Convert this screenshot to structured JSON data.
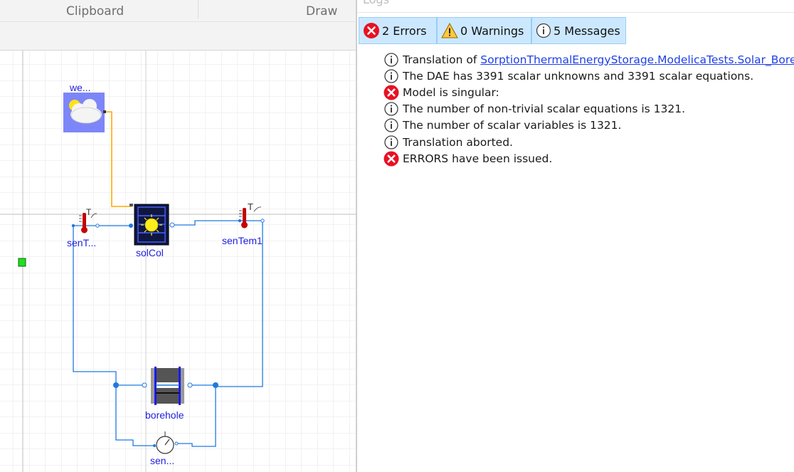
{
  "ribbon": {
    "clipboard_label": "Clipboard",
    "draw_label": "Draw"
  },
  "diagram": {
    "components": [
      {
        "id": "weather",
        "label": "we..."
      },
      {
        "id": "sen_t_left",
        "label": "senT..."
      },
      {
        "id": "solcol",
        "label": "solCol"
      },
      {
        "id": "sentem1",
        "label": "senTem1"
      },
      {
        "id": "borehole",
        "label": "borehole"
      },
      {
        "id": "sen_bottom",
        "label": "sen..."
      }
    ],
    "sensor_glyph": "T"
  },
  "logs": {
    "title": "Logs",
    "tabs": [
      {
        "icon": "error-icon",
        "label": "2 Errors"
      },
      {
        "icon": "warning-icon",
        "label": "0 Warnings"
      },
      {
        "icon": "info-icon",
        "label": "5 Messages"
      }
    ],
    "messages": [
      {
        "icon": "info-icon",
        "prefix": "Translation of ",
        "link": "SorptionThermalEnergyStorage.ModelicaTests.Solar_BoreHole",
        "suffix": ":"
      },
      {
        "icon": "info-icon",
        "text": "The DAE has 3391 scalar unknowns and 3391 scalar equations."
      },
      {
        "icon": "error-icon",
        "text": "Model is singular:"
      },
      {
        "icon": "info-icon",
        "text": "The number of non-trivial scalar equations is 1321."
      },
      {
        "icon": "info-icon",
        "text": "The number of scalar variables is 1321."
      },
      {
        "icon": "info-icon",
        "text": "Translation aborted."
      },
      {
        "icon": "error-icon",
        "text": "ERRORS have been issued."
      }
    ]
  },
  "colors": {
    "error": "#e81123",
    "warning": "#ffc83d",
    "info_stroke": "#404040",
    "wire_blue": "#1f7adf",
    "wire_orange": "#ffaa00",
    "tab_bg": "#cce8ff",
    "label_blue": "#1f1fe0",
    "link_blue": "#1f3fe6"
  }
}
